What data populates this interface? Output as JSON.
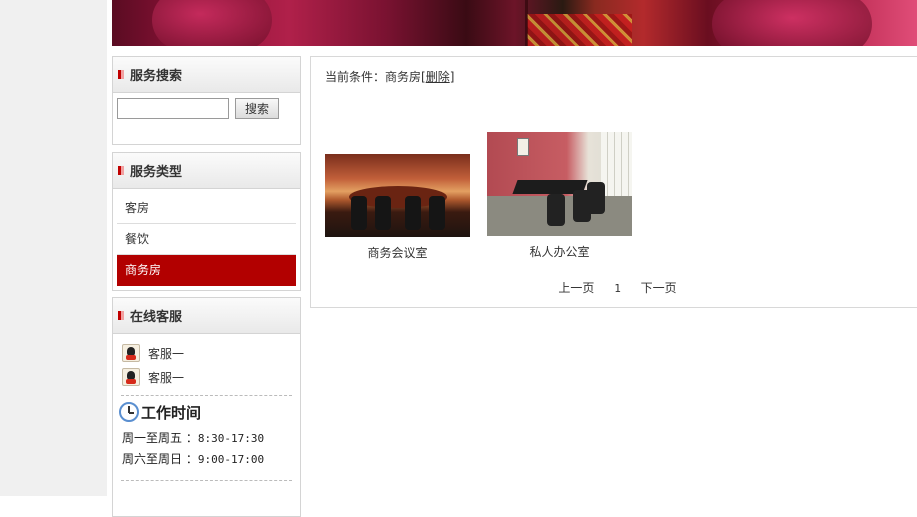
{
  "sidebar": {
    "search": {
      "title": "服务搜索",
      "input_value": "",
      "button_label": "搜索"
    },
    "types": {
      "title": "服务类型",
      "items": [
        {
          "label": "客房"
        },
        {
          "label": "餐饮"
        },
        {
          "label": "商务房"
        }
      ],
      "active_index": 2
    },
    "service": {
      "title": "在线客服",
      "agents": [
        {
          "label": "客服一"
        },
        {
          "label": "客服一"
        }
      ],
      "work_title": "工作时间",
      "hours": [
        {
          "days": "周一至周五",
          "sep": " ：",
          "time": "8:30-17:30"
        },
        {
          "days": "周六至周日",
          "sep": " ：",
          "time": "9:00-17:00"
        }
      ]
    }
  },
  "main": {
    "condition_prefix": "当前条件：商务房[",
    "condition_delete": "删除",
    "condition_suffix": "]",
    "products": [
      {
        "name": "商务会议室"
      },
      {
        "name": "私人办公室"
      }
    ],
    "pager": {
      "prev": "上一页",
      "page": "1",
      "next": "下一页"
    }
  },
  "colors": {
    "active_item": "#b20000",
    "banner": "#8e1238"
  },
  "icons": {
    "qq": "qq-icon",
    "clock": "clock-icon"
  }
}
